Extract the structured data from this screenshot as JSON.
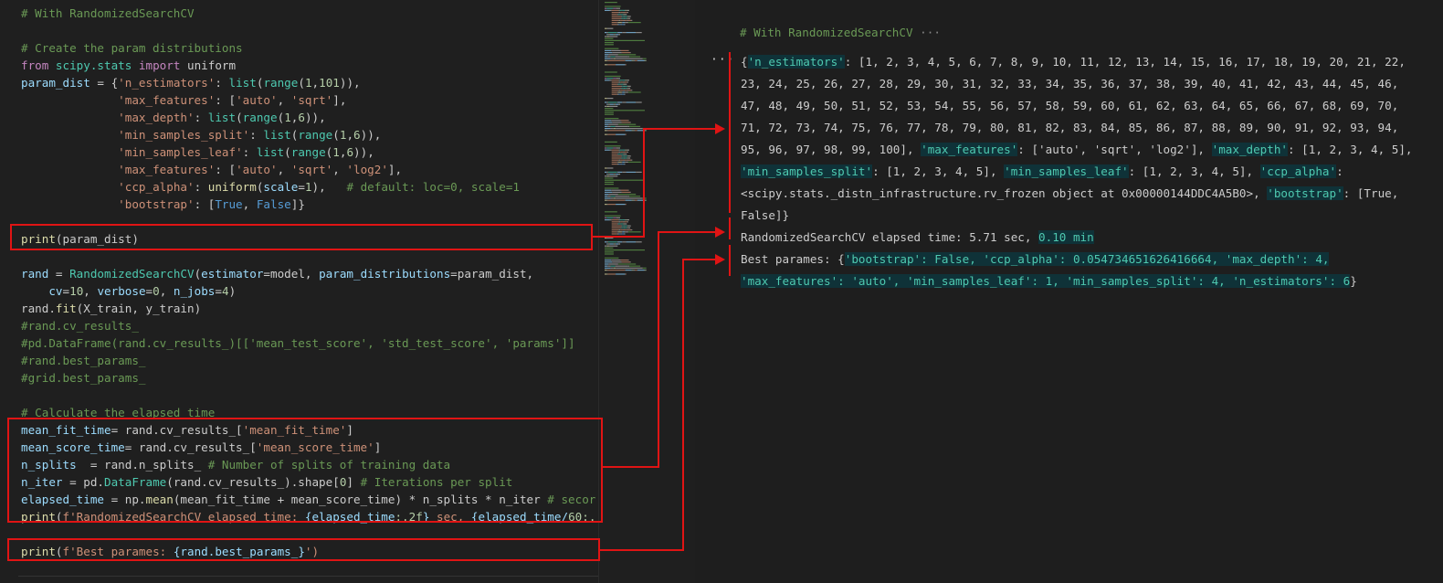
{
  "editor": {
    "lines": [
      [
        {
          "t": "# With RandomizedSearchCV",
          "c": "com"
        }
      ],
      [
        {
          "t": "",
          "c": "txt"
        }
      ],
      [
        {
          "t": "# Create the param distributions",
          "c": "com"
        }
      ],
      [
        {
          "t": "from",
          "c": "kw"
        },
        {
          "t": " scipy.stats ",
          "c": "cls"
        },
        {
          "t": "import",
          "c": "kw"
        },
        {
          "t": " uniform",
          "c": "txt"
        }
      ],
      [
        {
          "t": "param_dist",
          "c": "var"
        },
        {
          "t": " = {",
          "c": "txt"
        },
        {
          "t": "'n_estimators'",
          "c": "str"
        },
        {
          "t": ": ",
          "c": "txt"
        },
        {
          "t": "list",
          "c": "cls"
        },
        {
          "t": "(",
          "c": "txt"
        },
        {
          "t": "range",
          "c": "cls"
        },
        {
          "t": "(",
          "c": "txt"
        },
        {
          "t": "1",
          "c": "num"
        },
        {
          "t": ",",
          "c": "txt"
        },
        {
          "t": "101",
          "c": "num"
        },
        {
          "t": ")),",
          "c": "txt"
        }
      ],
      [
        {
          "t": "              ",
          "c": "txt"
        },
        {
          "t": "'max_features'",
          "c": "str"
        },
        {
          "t": ": [",
          "c": "txt"
        },
        {
          "t": "'auto'",
          "c": "str"
        },
        {
          "t": ", ",
          "c": "txt"
        },
        {
          "t": "'sqrt'",
          "c": "str"
        },
        {
          "t": "],",
          "c": "txt"
        }
      ],
      [
        {
          "t": "              ",
          "c": "txt"
        },
        {
          "t": "'max_depth'",
          "c": "str"
        },
        {
          "t": ": ",
          "c": "txt"
        },
        {
          "t": "list",
          "c": "cls"
        },
        {
          "t": "(",
          "c": "txt"
        },
        {
          "t": "range",
          "c": "cls"
        },
        {
          "t": "(",
          "c": "txt"
        },
        {
          "t": "1",
          "c": "num"
        },
        {
          "t": ",",
          "c": "txt"
        },
        {
          "t": "6",
          "c": "num"
        },
        {
          "t": ")),",
          "c": "txt"
        }
      ],
      [
        {
          "t": "              ",
          "c": "txt"
        },
        {
          "t": "'min_samples_split'",
          "c": "str"
        },
        {
          "t": ": ",
          "c": "txt"
        },
        {
          "t": "list",
          "c": "cls"
        },
        {
          "t": "(",
          "c": "txt"
        },
        {
          "t": "range",
          "c": "cls"
        },
        {
          "t": "(",
          "c": "txt"
        },
        {
          "t": "1",
          "c": "num"
        },
        {
          "t": ",",
          "c": "txt"
        },
        {
          "t": "6",
          "c": "num"
        },
        {
          "t": ")),",
          "c": "txt"
        }
      ],
      [
        {
          "t": "              ",
          "c": "txt"
        },
        {
          "t": "'min_samples_leaf'",
          "c": "str"
        },
        {
          "t": ": ",
          "c": "txt"
        },
        {
          "t": "list",
          "c": "cls"
        },
        {
          "t": "(",
          "c": "txt"
        },
        {
          "t": "range",
          "c": "cls"
        },
        {
          "t": "(",
          "c": "txt"
        },
        {
          "t": "1",
          "c": "num"
        },
        {
          "t": ",",
          "c": "txt"
        },
        {
          "t": "6",
          "c": "num"
        },
        {
          "t": ")),",
          "c": "txt"
        }
      ],
      [
        {
          "t": "              ",
          "c": "txt"
        },
        {
          "t": "'max_features'",
          "c": "str"
        },
        {
          "t": ": [",
          "c": "txt"
        },
        {
          "t": "'auto'",
          "c": "str"
        },
        {
          "t": ", ",
          "c": "txt"
        },
        {
          "t": "'sqrt'",
          "c": "str"
        },
        {
          "t": ", ",
          "c": "txt"
        },
        {
          "t": "'log2'",
          "c": "str"
        },
        {
          "t": "],",
          "c": "txt"
        }
      ],
      [
        {
          "t": "              ",
          "c": "txt"
        },
        {
          "t": "'ccp_alpha'",
          "c": "str"
        },
        {
          "t": ": ",
          "c": "txt"
        },
        {
          "t": "uniform",
          "c": "fn"
        },
        {
          "t": "(",
          "c": "txt"
        },
        {
          "t": "scale",
          "c": "var"
        },
        {
          "t": "=",
          "c": "txt"
        },
        {
          "t": "1",
          "c": "num"
        },
        {
          "t": "),   ",
          "c": "txt"
        },
        {
          "t": "# default: loc=0, scale=1",
          "c": "com"
        }
      ],
      [
        {
          "t": "              ",
          "c": "txt"
        },
        {
          "t": "'bootstrap'",
          "c": "str"
        },
        {
          "t": ": [",
          "c": "txt"
        },
        {
          "t": "True",
          "c": "bool"
        },
        {
          "t": ", ",
          "c": "txt"
        },
        {
          "t": "False",
          "c": "bool"
        },
        {
          "t": "]}",
          "c": "txt"
        }
      ],
      [
        {
          "t": "",
          "c": "txt"
        }
      ],
      [
        {
          "t": "print",
          "c": "fn"
        },
        {
          "t": "(param_dist)",
          "c": "txt"
        }
      ],
      [
        {
          "t": "",
          "c": "txt"
        }
      ],
      [
        {
          "t": "rand",
          "c": "var"
        },
        {
          "t": " = ",
          "c": "txt"
        },
        {
          "t": "RandomizedSearchCV",
          "c": "cls"
        },
        {
          "t": "(",
          "c": "txt"
        },
        {
          "t": "estimator",
          "c": "var"
        },
        {
          "t": "=model, ",
          "c": "txt"
        },
        {
          "t": "param_distributions",
          "c": "var"
        },
        {
          "t": "=param_dist,",
          "c": "txt"
        }
      ],
      [
        {
          "t": "    ",
          "c": "txt"
        },
        {
          "t": "cv",
          "c": "var"
        },
        {
          "t": "=",
          "c": "txt"
        },
        {
          "t": "10",
          "c": "num"
        },
        {
          "t": ", ",
          "c": "txt"
        },
        {
          "t": "verbose",
          "c": "var"
        },
        {
          "t": "=",
          "c": "txt"
        },
        {
          "t": "0",
          "c": "num"
        },
        {
          "t": ", ",
          "c": "txt"
        },
        {
          "t": "n_jobs",
          "c": "var"
        },
        {
          "t": "=",
          "c": "txt"
        },
        {
          "t": "4",
          "c": "num"
        },
        {
          "t": ")",
          "c": "txt"
        }
      ],
      [
        {
          "t": "rand.",
          "c": "txt"
        },
        {
          "t": "fit",
          "c": "fn"
        },
        {
          "t": "(X_train, y_train)",
          "c": "txt"
        }
      ],
      [
        {
          "t": "#rand.cv_results_",
          "c": "com"
        }
      ],
      [
        {
          "t": "#pd.DataFrame(rand.cv_results_)[['mean_test_score', 'std_test_score', 'params']]",
          "c": "com"
        }
      ],
      [
        {
          "t": "#rand.best_params_",
          "c": "com"
        }
      ],
      [
        {
          "t": "#grid.best_params_",
          "c": "com"
        }
      ],
      [
        {
          "t": "",
          "c": "txt"
        }
      ],
      [
        {
          "t": "# Calculate the elapsed time",
          "c": "com"
        }
      ],
      [
        {
          "t": "mean_fit_time",
          "c": "var"
        },
        {
          "t": "= rand.cv_results_[",
          "c": "txt"
        },
        {
          "t": "'mean_fit_time'",
          "c": "str"
        },
        {
          "t": "]",
          "c": "txt"
        }
      ],
      [
        {
          "t": "mean_score_time",
          "c": "var"
        },
        {
          "t": "= rand.cv_results_[",
          "c": "txt"
        },
        {
          "t": "'mean_score_time'",
          "c": "str"
        },
        {
          "t": "]",
          "c": "txt"
        }
      ],
      [
        {
          "t": "n_splits",
          "c": "var"
        },
        {
          "t": "  = rand.n_splits_ ",
          "c": "txt"
        },
        {
          "t": "# Number of splits of training data",
          "c": "com"
        }
      ],
      [
        {
          "t": "n_iter",
          "c": "var"
        },
        {
          "t": " = pd.",
          "c": "txt"
        },
        {
          "t": "DataFrame",
          "c": "cls"
        },
        {
          "t": "(rand.cv_results_).shape[",
          "c": "txt"
        },
        {
          "t": "0",
          "c": "num"
        },
        {
          "t": "] ",
          "c": "txt"
        },
        {
          "t": "# Iterations per split",
          "c": "com"
        }
      ],
      [
        {
          "t": "elapsed_time",
          "c": "var"
        },
        {
          "t": " = np.",
          "c": "txt"
        },
        {
          "t": "mean",
          "c": "fn"
        },
        {
          "t": "(mean_fit_time + mean_score_time) * n_splits * n_iter ",
          "c": "txt"
        },
        {
          "t": "# secor",
          "c": "com"
        }
      ],
      [
        {
          "t": "print",
          "c": "fn"
        },
        {
          "t": "(",
          "c": "txt"
        },
        {
          "t": "f'RandomizedSearchCV elapsed time: ",
          "c": "str"
        },
        {
          "t": "{elapsed_time",
          "c": "var"
        },
        {
          "t": ":.2f",
          "c": "num"
        },
        {
          "t": "}",
          "c": "var"
        },
        {
          "t": " sec, ",
          "c": "str"
        },
        {
          "t": "{elapsed_time/",
          "c": "var"
        },
        {
          "t": "60",
          "c": "num"
        },
        {
          "t": ":.",
          "c": "num"
        }
      ],
      [
        {
          "t": "",
          "c": "txt"
        }
      ],
      [
        {
          "t": "print",
          "c": "fn"
        },
        {
          "t": "(",
          "c": "txt"
        },
        {
          "t": "f'Best parames: ",
          "c": "str"
        },
        {
          "t": "{rand.best_params_}",
          "c": "var"
        },
        {
          "t": "')",
          "c": "str"
        }
      ]
    ]
  },
  "output": {
    "header": "# With RandomizedSearchCV",
    "header_more": "···",
    "ellipsis": "···",
    "lines": [
      [
        {
          "t": "{",
          "c": "txt"
        },
        {
          "t": "'n_estimators'",
          "c": "hl"
        },
        {
          "t": ": [1, 2, 3, 4, 5, 6, 7, 8, 9, 10, 11, 12, 13, 14, 15, 16, 17, 18, 19, 20, 21, 22,",
          "c": "txt"
        }
      ],
      [
        {
          "t": "23, 24, 25, 26, 27, 28, 29, 30, 31, 32, 33, 34, 35, 36, 37, 38, 39, 40, 41, 42, 43, 44, 45, 46,",
          "c": "txt"
        }
      ],
      [
        {
          "t": "47, 48, 49, 50, 51, 52, 53, 54, 55, 56, 57, 58, 59, 60, 61, 62, 63, 64, 65, 66, 67, 68, 69, 70,",
          "c": "txt"
        }
      ],
      [
        {
          "t": "71, 72, 73, 74, 75, 76, 77, 78, 79, 80, 81, 82, 83, 84, 85, 86, 87, 88, 89, 90, 91, 92, 93, 94,",
          "c": "txt"
        }
      ],
      [
        {
          "t": "95, 96, 97, 98, 99, 100], ",
          "c": "txt"
        },
        {
          "t": "'max_features'",
          "c": "hl"
        },
        {
          "t": ": ['auto', 'sqrt', 'log2'], ",
          "c": "txt"
        },
        {
          "t": "'max_depth'",
          "c": "hl"
        },
        {
          "t": ": [1, 2, 3, 4, 5],",
          "c": "txt"
        }
      ],
      [
        {
          "t": "'min_samples_split'",
          "c": "hl"
        },
        {
          "t": ": [1, 2, 3, 4, 5], ",
          "c": "txt"
        },
        {
          "t": "'min_samples_leaf'",
          "c": "hl"
        },
        {
          "t": ": [1, 2, 3, 4, 5], ",
          "c": "txt"
        },
        {
          "t": "'ccp_alpha'",
          "c": "hl"
        },
        {
          "t": ":",
          "c": "txt"
        }
      ],
      [
        {
          "t": "<scipy.stats._distn_infrastructure.rv_frozen object at 0x00000144DDC4A5B0>, ",
          "c": "txt"
        },
        {
          "t": "'bootstrap'",
          "c": "hl"
        },
        {
          "t": ": [True,",
          "c": "txt"
        }
      ],
      [
        {
          "t": "False]}",
          "c": "txt"
        }
      ],
      [
        {
          "t": "RandomizedSearchCV elapsed time: 5.71 sec, ",
          "c": "txt"
        },
        {
          "t": "0.10 min",
          "c": "hl"
        }
      ],
      [
        {
          "t": "Best parames: {",
          "c": "txt"
        },
        {
          "t": "'bootstrap': False, 'ccp_alpha': 0.054734651626416664, 'max_depth': 4,",
          "c": "hl"
        }
      ],
      [
        {
          "t": "'max_features': 'auto', 'min_samples_leaf': 1, 'min_samples_split': 4, 'n_estimators': 6",
          "c": "hl"
        },
        {
          "t": "}",
          "c": "txt"
        }
      ]
    ]
  },
  "colors": {
    "annotation_red": "#e01414",
    "comment": "#6a9955",
    "string": "#ce9178",
    "keyword": "#c586c0",
    "function": "#dcdcaa",
    "class": "#4ec9b0",
    "variable": "#9cdcfe",
    "number": "#b5cea8",
    "boolean": "#569cd6",
    "output_highlight_bg": "#0f3238"
  }
}
